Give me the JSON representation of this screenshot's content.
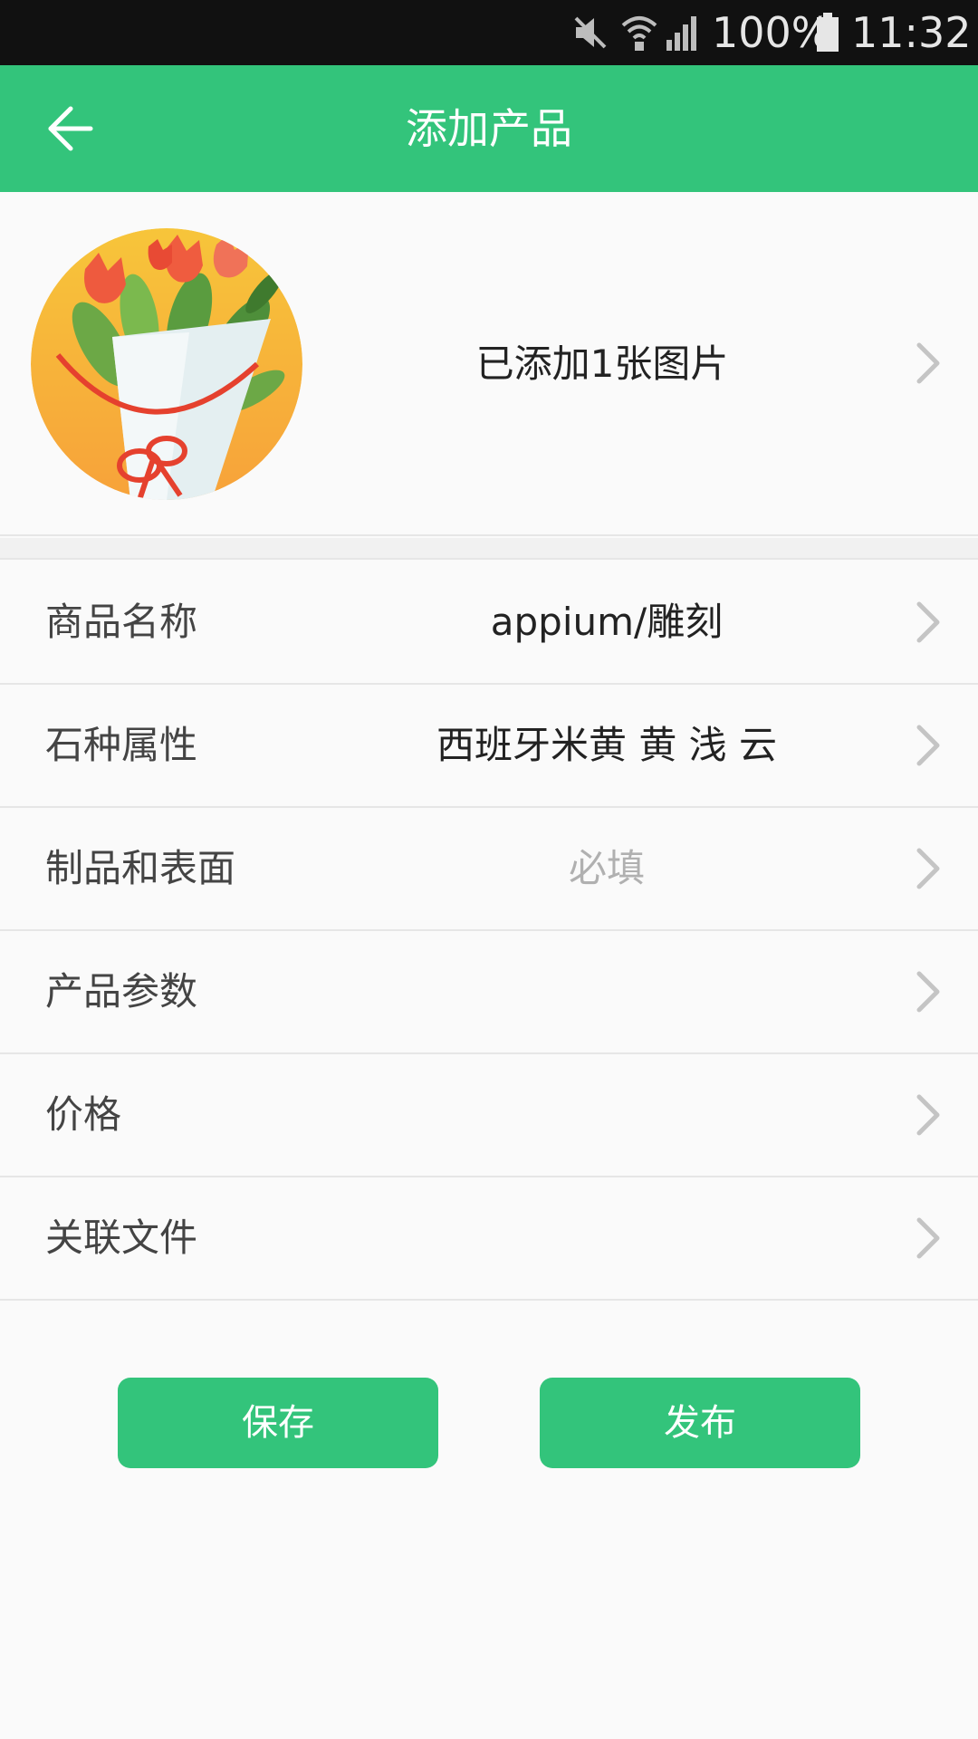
{
  "status_bar": {
    "battery": "100%",
    "time": "11:32",
    "icons": [
      "mute-icon",
      "wifi-icon",
      "signal-icon",
      "battery-icon"
    ]
  },
  "app_bar": {
    "title": "添加产品",
    "back_icon": "arrow-left-icon"
  },
  "image_row": {
    "count_text": "已添加1张图片",
    "thumbnail": "flower-bouquet-image"
  },
  "form": {
    "rows": [
      {
        "label": "商品名称",
        "value": "appium/雕刻"
      },
      {
        "label": "石种属性",
        "value": "西班牙米黄 黄 浅 云"
      },
      {
        "label": "制品和表面",
        "value": "必填"
      },
      {
        "label": "产品参数",
        "value": ""
      },
      {
        "label": "价格",
        "value": ""
      },
      {
        "label": "关联文件",
        "value": ""
      }
    ]
  },
  "actions": {
    "save": "保存",
    "publish": "发布"
  },
  "colors": {
    "accent": "#33c47b",
    "status_bar": "#111111",
    "background": "#fafafa",
    "placeholder": "#b0b0b0"
  }
}
